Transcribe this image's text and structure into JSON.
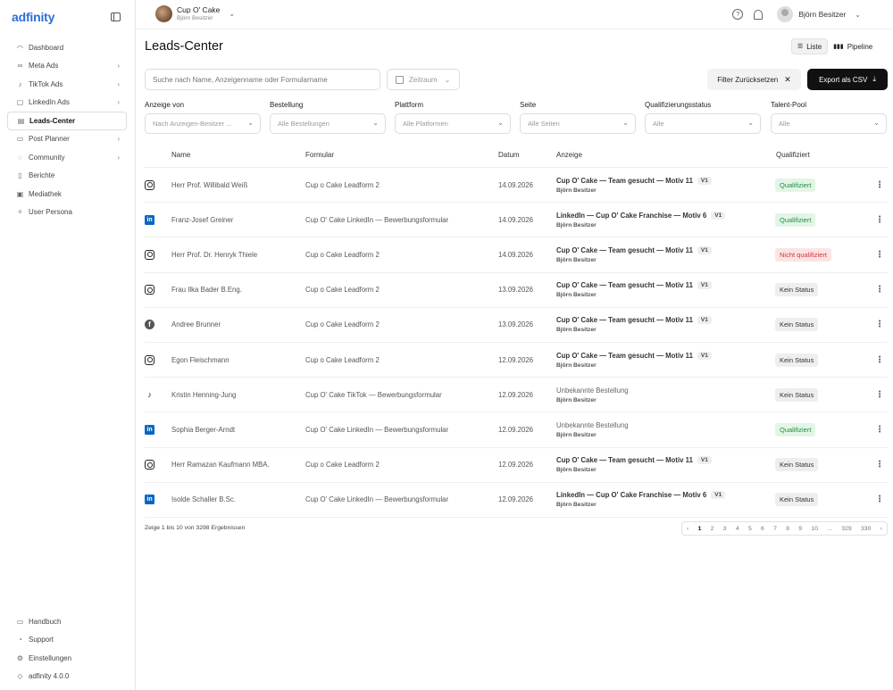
{
  "app": {
    "logo": "adfinity"
  },
  "sidebar": {
    "items": [
      {
        "label": "Dashboard",
        "icon": "◠",
        "chev": ""
      },
      {
        "label": "Meta Ads",
        "icon": "∞",
        "chev": "›"
      },
      {
        "label": "TikTok Ads",
        "icon": "♪",
        "chev": "›"
      },
      {
        "label": "LinkedIn Ads",
        "icon": "▢",
        "chev": "›"
      },
      {
        "label": "Leads-Center",
        "icon": "▤",
        "chev": ""
      },
      {
        "label": "Post Planner",
        "icon": "▭",
        "chev": "›"
      },
      {
        "label": "Community",
        "icon": "◌",
        "chev": "›"
      },
      {
        "label": "Berichte",
        "icon": "▯",
        "chev": ""
      },
      {
        "label": "Mediathek",
        "icon": "▣",
        "chev": ""
      },
      {
        "label": "User Persona",
        "icon": "✧",
        "chev": ""
      }
    ],
    "bottom": [
      {
        "label": "Handbuch",
        "icon": "▭"
      },
      {
        "label": "Support",
        "icon": "◔"
      },
      {
        "label": "Einstellungen",
        "icon": "⚙"
      },
      {
        "label": "adfinity 4.0.0",
        "icon": "◇"
      }
    ]
  },
  "topbar": {
    "account_name": "Cup O' Cake",
    "account_role": "Björn Besitzer",
    "help_icon": "?",
    "user_name": "Björn Besitzer"
  },
  "page": {
    "title": "Leads-Center",
    "view_list": "Liste",
    "view_pipeline": "Pipeline"
  },
  "toolbar": {
    "search_placeholder": "Suche nach Name, Anzeigenname oder Formularname",
    "date_placeholder": "Zeitraum",
    "reset_label": "Filter Zurücksetzen",
    "export_label": "Export als CSV"
  },
  "filters": [
    {
      "label": "Anzeige von",
      "value": "Nach Anzeigen-Besitzer ..."
    },
    {
      "label": "Bestellung",
      "value": "Alle Bestellungen"
    },
    {
      "label": "Plattform",
      "value": "Alle Platformen"
    },
    {
      "label": "Seite",
      "value": "Alle Seiten"
    },
    {
      "label": "Qualifizierungsstatus",
      "value": "Alle"
    },
    {
      "label": "Talent-Pool",
      "value": "Alle"
    }
  ],
  "table": {
    "headers": {
      "name": "Name",
      "form": "Formular",
      "date": "Datum",
      "ad": "Anzeige",
      "qualified": "Qualifiziert"
    },
    "rows": [
      {
        "platform": "instagram",
        "name": "Herr Prof. Willibald Weiß",
        "form": "Cup o Cake Leadform 2",
        "date": "14.09.2026",
        "ad": "Cup O' Cake — Team gesucht — Motiv 11",
        "ver": "V1",
        "owner": "Björn Besitzer",
        "status": "Qualifiziert",
        "kind": "ok"
      },
      {
        "platform": "linkedin",
        "name": "Franz-Josef Greiner",
        "form": "Cup O' Cake LinkedIn — Bewerbungsformular",
        "date": "14.09.2026",
        "ad": "LinkedIn — Cup O' Cake Franchise — Motiv 6",
        "ver": "V1",
        "owner": "Björn Besitzer",
        "status": "Qualifiziert",
        "kind": "ok"
      },
      {
        "platform": "instagram",
        "name": "Herr Prof. Dr. Henryk Thiele",
        "form": "Cup o Cake Leadform 2",
        "date": "14.09.2026",
        "ad": "Cup O' Cake — Team gesucht — Motiv 11",
        "ver": "V1",
        "owner": "Björn Besitzer",
        "status": "Nicht qualifiziert",
        "kind": "bad"
      },
      {
        "platform": "instagram",
        "name": "Frau Ilka Bader B.Eng.",
        "form": "Cup o Cake Leadform 2",
        "date": "13.09.2026",
        "ad": "Cup O' Cake — Team gesucht — Motiv 11",
        "ver": "V1",
        "owner": "Björn Besitzer",
        "status": "Kein Status",
        "kind": "none"
      },
      {
        "platform": "facebook",
        "name": "Andree Brunner",
        "form": "Cup o Cake Leadform 2",
        "date": "13.09.2026",
        "ad": "Cup O' Cake — Team gesucht — Motiv 11",
        "ver": "V1",
        "owner": "Björn Besitzer",
        "status": "Kein Status",
        "kind": "none"
      },
      {
        "platform": "instagram",
        "name": "Egon Fleischmann",
        "form": "Cup o Cake Leadform 2",
        "date": "12.09.2026",
        "ad": "Cup O' Cake — Team gesucht — Motiv 11",
        "ver": "V1",
        "owner": "Björn Besitzer",
        "status": "Kein Status",
        "kind": "none"
      },
      {
        "platform": "tiktok",
        "name": "Kristin Henning-Jung",
        "form": "Cup O' Cake TikTok — Bewerbungsformular",
        "date": "12.09.2026",
        "ad": "Unbekannte Bestellung",
        "ver": "",
        "owner": "Björn Besitzer",
        "status": "Kein Status",
        "kind": "none"
      },
      {
        "platform": "linkedin",
        "name": "Sophia Berger-Arndt",
        "form": "Cup O' Cake LinkedIn — Bewerbungsformular",
        "date": "12.09.2026",
        "ad": "Unbekannte Bestellung",
        "ver": "",
        "owner": "Björn Besitzer",
        "status": "Qualifiziert",
        "kind": "ok"
      },
      {
        "platform": "instagram",
        "name": "Herr Ramazan Kaufmann MBA.",
        "form": "Cup o Cake Leadform 2",
        "date": "12.09.2026",
        "ad": "Cup O' Cake — Team gesucht — Motiv 11",
        "ver": "V1",
        "owner": "Björn Besitzer",
        "status": "Kein Status",
        "kind": "none"
      },
      {
        "platform": "linkedin",
        "name": "Isolde Schaller B.Sc.",
        "form": "Cup O' Cake LinkedIn — Bewerbungsformular",
        "date": "12.09.2026",
        "ad": "LinkedIn — Cup O' Cake Franchise — Motiv 6",
        "ver": "V1",
        "owner": "Björn Besitzer",
        "status": "Kein Status",
        "kind": "none"
      }
    ]
  },
  "footer": {
    "info": "Zeige 1 bis 10 von 3298 Ergebnissen",
    "pages": [
      "‹",
      "1",
      "2",
      "3",
      "4",
      "5",
      "6",
      "7",
      "8",
      "9",
      "10",
      "...",
      "329",
      "330",
      "›"
    ],
    "current_page": "1"
  }
}
